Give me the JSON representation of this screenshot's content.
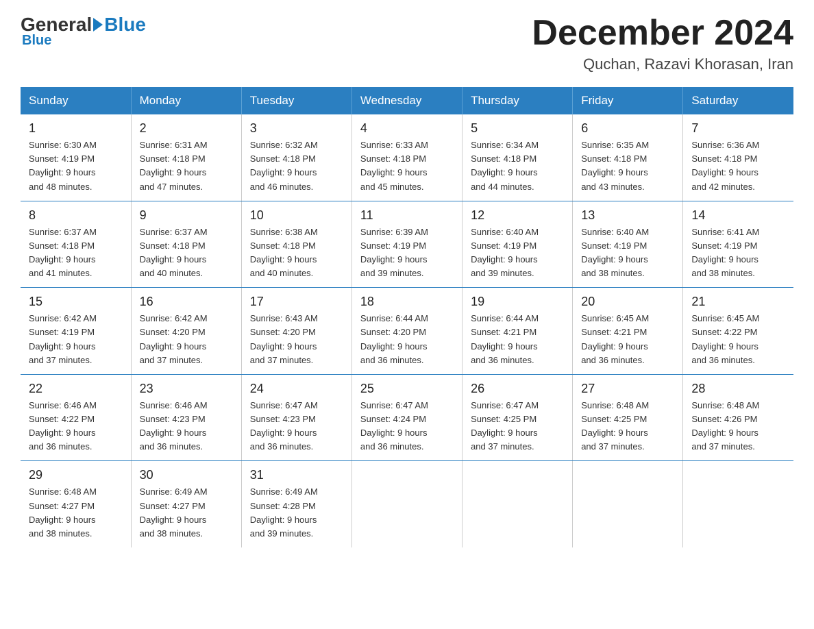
{
  "header": {
    "logo_general": "General",
    "logo_blue": "Blue",
    "month_title": "December 2024",
    "location": "Quchan, Razavi Khorasan, Iran"
  },
  "weekdays": [
    "Sunday",
    "Monday",
    "Tuesday",
    "Wednesday",
    "Thursday",
    "Friday",
    "Saturday"
  ],
  "weeks": [
    [
      {
        "day": "1",
        "sunrise": "6:30 AM",
        "sunset": "4:19 PM",
        "daylight": "9 hours and 48 minutes."
      },
      {
        "day": "2",
        "sunrise": "6:31 AM",
        "sunset": "4:18 PM",
        "daylight": "9 hours and 47 minutes."
      },
      {
        "day": "3",
        "sunrise": "6:32 AM",
        "sunset": "4:18 PM",
        "daylight": "9 hours and 46 minutes."
      },
      {
        "day": "4",
        "sunrise": "6:33 AM",
        "sunset": "4:18 PM",
        "daylight": "9 hours and 45 minutes."
      },
      {
        "day": "5",
        "sunrise": "6:34 AM",
        "sunset": "4:18 PM",
        "daylight": "9 hours and 44 minutes."
      },
      {
        "day": "6",
        "sunrise": "6:35 AM",
        "sunset": "4:18 PM",
        "daylight": "9 hours and 43 minutes."
      },
      {
        "day": "7",
        "sunrise": "6:36 AM",
        "sunset": "4:18 PM",
        "daylight": "9 hours and 42 minutes."
      }
    ],
    [
      {
        "day": "8",
        "sunrise": "6:37 AM",
        "sunset": "4:18 PM",
        "daylight": "9 hours and 41 minutes."
      },
      {
        "day": "9",
        "sunrise": "6:37 AM",
        "sunset": "4:18 PM",
        "daylight": "9 hours and 40 minutes."
      },
      {
        "day": "10",
        "sunrise": "6:38 AM",
        "sunset": "4:18 PM",
        "daylight": "9 hours and 40 minutes."
      },
      {
        "day": "11",
        "sunrise": "6:39 AM",
        "sunset": "4:19 PM",
        "daylight": "9 hours and 39 minutes."
      },
      {
        "day": "12",
        "sunrise": "6:40 AM",
        "sunset": "4:19 PM",
        "daylight": "9 hours and 39 minutes."
      },
      {
        "day": "13",
        "sunrise": "6:40 AM",
        "sunset": "4:19 PM",
        "daylight": "9 hours and 38 minutes."
      },
      {
        "day": "14",
        "sunrise": "6:41 AM",
        "sunset": "4:19 PM",
        "daylight": "9 hours and 38 minutes."
      }
    ],
    [
      {
        "day": "15",
        "sunrise": "6:42 AM",
        "sunset": "4:19 PM",
        "daylight": "9 hours and 37 minutes."
      },
      {
        "day": "16",
        "sunrise": "6:42 AM",
        "sunset": "4:20 PM",
        "daylight": "9 hours and 37 minutes."
      },
      {
        "day": "17",
        "sunrise": "6:43 AM",
        "sunset": "4:20 PM",
        "daylight": "9 hours and 37 minutes."
      },
      {
        "day": "18",
        "sunrise": "6:44 AM",
        "sunset": "4:20 PM",
        "daylight": "9 hours and 36 minutes."
      },
      {
        "day": "19",
        "sunrise": "6:44 AM",
        "sunset": "4:21 PM",
        "daylight": "9 hours and 36 minutes."
      },
      {
        "day": "20",
        "sunrise": "6:45 AM",
        "sunset": "4:21 PM",
        "daylight": "9 hours and 36 minutes."
      },
      {
        "day": "21",
        "sunrise": "6:45 AM",
        "sunset": "4:22 PM",
        "daylight": "9 hours and 36 minutes."
      }
    ],
    [
      {
        "day": "22",
        "sunrise": "6:46 AM",
        "sunset": "4:22 PM",
        "daylight": "9 hours and 36 minutes."
      },
      {
        "day": "23",
        "sunrise": "6:46 AM",
        "sunset": "4:23 PM",
        "daylight": "9 hours and 36 minutes."
      },
      {
        "day": "24",
        "sunrise": "6:47 AM",
        "sunset": "4:23 PM",
        "daylight": "9 hours and 36 minutes."
      },
      {
        "day": "25",
        "sunrise": "6:47 AM",
        "sunset": "4:24 PM",
        "daylight": "9 hours and 36 minutes."
      },
      {
        "day": "26",
        "sunrise": "6:47 AM",
        "sunset": "4:25 PM",
        "daylight": "9 hours and 37 minutes."
      },
      {
        "day": "27",
        "sunrise": "6:48 AM",
        "sunset": "4:25 PM",
        "daylight": "9 hours and 37 minutes."
      },
      {
        "day": "28",
        "sunrise": "6:48 AM",
        "sunset": "4:26 PM",
        "daylight": "9 hours and 37 minutes."
      }
    ],
    [
      {
        "day": "29",
        "sunrise": "6:48 AM",
        "sunset": "4:27 PM",
        "daylight": "9 hours and 38 minutes."
      },
      {
        "day": "30",
        "sunrise": "6:49 AM",
        "sunset": "4:27 PM",
        "daylight": "9 hours and 38 minutes."
      },
      {
        "day": "31",
        "sunrise": "6:49 AM",
        "sunset": "4:28 PM",
        "daylight": "9 hours and 39 minutes."
      },
      null,
      null,
      null,
      null
    ]
  ],
  "labels": {
    "sunrise_prefix": "Sunrise: ",
    "sunset_prefix": "Sunset: ",
    "daylight_prefix": "Daylight: "
  }
}
